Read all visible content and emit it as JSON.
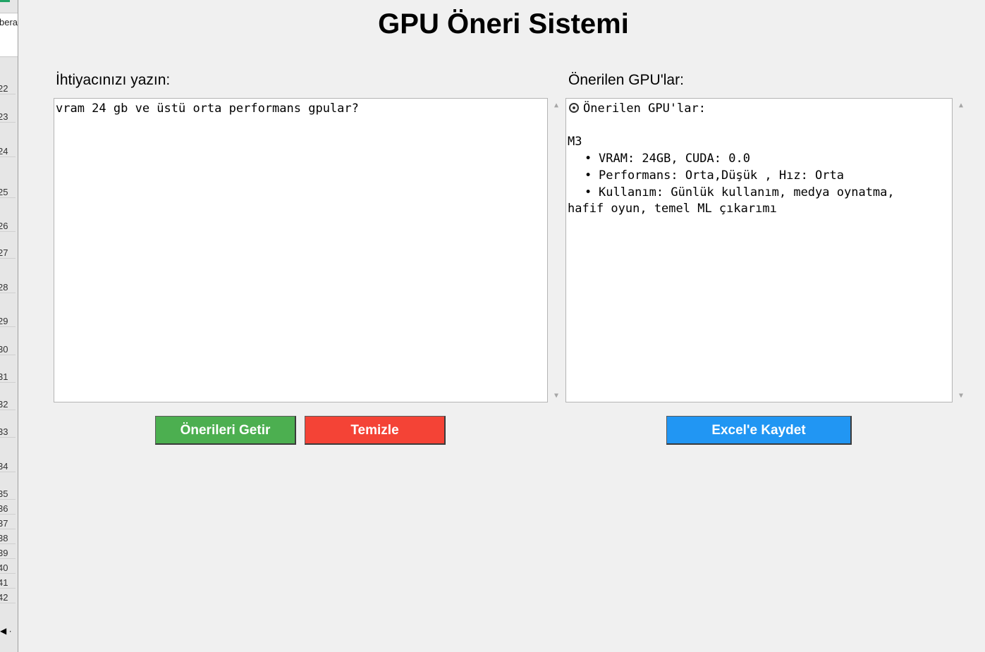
{
  "background_sheet": {
    "cell_text": "bera",
    "row_numbers": [
      "22",
      "23",
      "24",
      "25",
      "26",
      "27",
      "28",
      "29",
      "30",
      "31",
      "32",
      "33",
      "34",
      "35",
      "36",
      "37",
      "38",
      "39",
      "40",
      "41",
      "42"
    ]
  },
  "app": {
    "title": "GPU Öneri Sistemi",
    "input": {
      "label": "İhtiyacınızı yazın:",
      "value": "vram 24 gb ve üstü orta performans gpular?"
    },
    "output": {
      "label": "Önerilen GPU'lar:",
      "icon": "target-icon",
      "header": "Önerilen GPU'lar:",
      "gpu_name": "M3",
      "lines": [
        "VRAM: 24GB, CUDA: 0.0",
        "Performans: Orta,Düşük , Hız: Orta",
        "Kullanım: Günlük kullanım, medya oynatma,"
      ],
      "wrap_line": "hafif oyun, temel ML çıkarımı"
    },
    "buttons": {
      "get": "Önerileri Getir",
      "clear": "Temizle",
      "excel": "Excel'e Kaydet"
    },
    "colors": {
      "get": "#4caf50",
      "clear": "#f44336",
      "excel": "#2196f3"
    }
  }
}
